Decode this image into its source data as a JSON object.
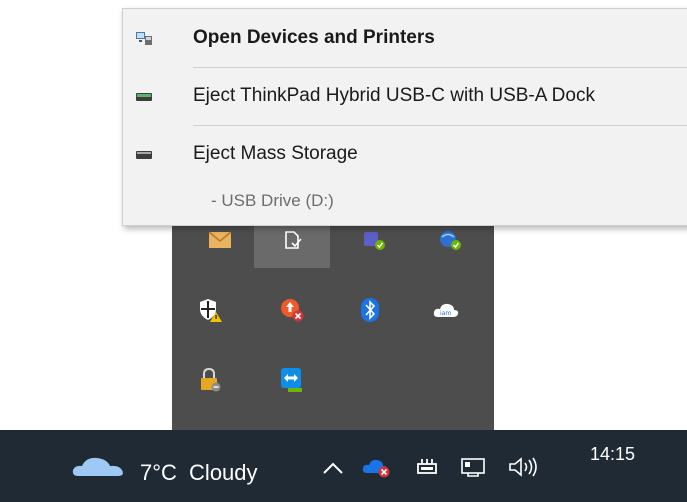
{
  "context_menu": {
    "items": [
      {
        "label": "Open Devices and Printers",
        "icon": "devices-printers-icon",
        "bold": true
      },
      {
        "label": "Eject ThinkPad Hybrid USB-C with USB-A Dock",
        "icon": "dock-drive-icon",
        "bold": false
      },
      {
        "label": "Eject Mass Storage",
        "icon": "drive-icon",
        "bold": false,
        "sub_label": "-   USB Drive (D:)"
      }
    ]
  },
  "tray_icons": [
    {
      "name": "mail-icon"
    },
    {
      "name": "usb-safely-remove-icon"
    },
    {
      "name": "teams-status-icon"
    },
    {
      "name": "network-status-icon"
    },
    {
      "name": "security-warning-icon"
    },
    {
      "name": "update-error-icon"
    },
    {
      "name": "bluetooth-icon"
    },
    {
      "name": "cloud-sync-icon"
    },
    {
      "name": "vpn-lock-icon"
    },
    {
      "name": "teamviewer-icon"
    }
  ],
  "taskbar": {
    "weather": {
      "temperature": "7°C",
      "condition": "Cloudy",
      "icon": "cloud-icon"
    },
    "clock": "14:15",
    "system_icons": [
      "chevron-up-icon",
      "onedrive-error-icon",
      "usb-device-icon",
      "network-icon",
      "volume-icon"
    ]
  },
  "colors": {
    "taskbar_bg": "#1f2a35",
    "flyout_bg": "#4d4d4d",
    "menu_bg": "#f2f2f2",
    "bluetooth_blue": "#1a73e8"
  }
}
